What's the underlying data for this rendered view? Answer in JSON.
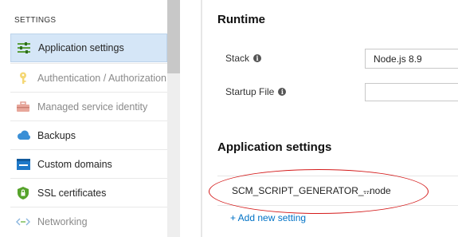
{
  "sidebar": {
    "section_header": "SETTINGS",
    "items": [
      {
        "label": "Application settings",
        "icon": "list-settings-icon",
        "active": true
      },
      {
        "label": "Authentication / Authorization",
        "icon": "key-icon",
        "disabled": true
      },
      {
        "label": "Managed service identity",
        "icon": "briefcase-icon",
        "disabled": true
      },
      {
        "label": "Backups",
        "icon": "cloud-icon"
      },
      {
        "label": "Custom domains",
        "icon": "www-icon"
      },
      {
        "label": "SSL certificates",
        "icon": "shield-icon"
      },
      {
        "label": "Networking",
        "icon": "networking-icon",
        "disabled": true
      }
    ]
  },
  "runtime": {
    "title": "Runtime",
    "stack_label": "Stack",
    "stack_value": "Node.js 8.9",
    "startup_label": "Startup File",
    "startup_value": ""
  },
  "app_settings": {
    "title": "Application settings",
    "rows": [
      {
        "name": "SCM_SCRIPT_GENERATOR_...",
        "value": "--node"
      }
    ],
    "add_label": "+ Add new setting"
  },
  "colors": {
    "accent": "#0072c6",
    "active_bg": "#d5e6f7",
    "annotation": "#d41b1b"
  }
}
